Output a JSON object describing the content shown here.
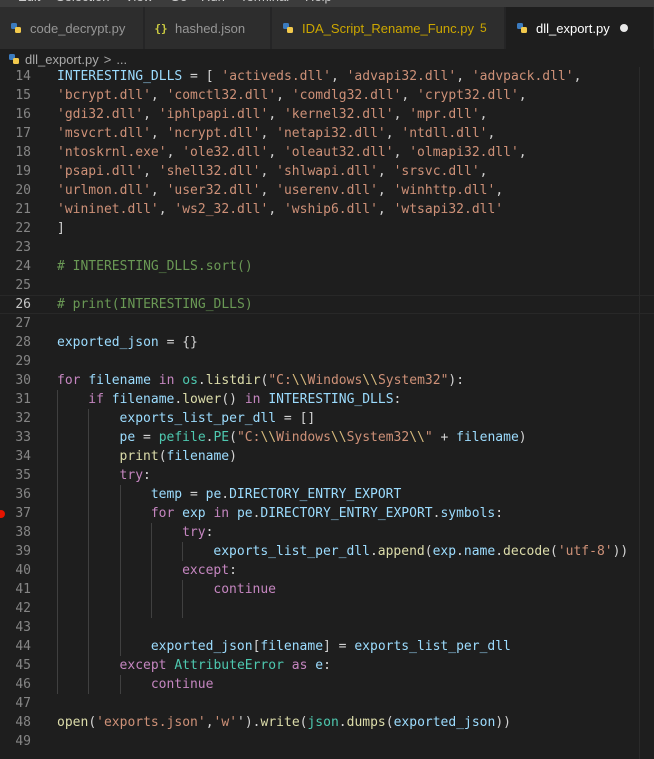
{
  "menu": [
    "Edit",
    "Selection",
    "View",
    "Go",
    "Run",
    "Terminal",
    "Help"
  ],
  "tabs": [
    {
      "label": "code_decrypt.py",
      "icon": "python-icon",
      "active": false
    },
    {
      "label": "hashed.json",
      "icon": "json-braces-icon",
      "active": false
    },
    {
      "label": "IDA_Script_Rename_Func.py",
      "icon": "python-icon",
      "active": false,
      "badge": "5"
    },
    {
      "label": "dll_export.py",
      "icon": "python-icon",
      "active": true,
      "unsaved_indicator": "dot"
    }
  ],
  "breadcrumb": {
    "file": "dll_export.py",
    "separator": ">",
    "rest": "..."
  },
  "current_line": 26,
  "breakpoint_line": 37,
  "lines": [
    {
      "n": "14",
      "indent": 0,
      "tokens": [
        [
          "var",
          "INTERESTING_DLLS"
        ],
        [
          "op",
          " = [ "
        ],
        [
          "str",
          "'activeds.dll'"
        ],
        [
          "op",
          ", "
        ],
        [
          "str",
          "'advapi32.dll'"
        ],
        [
          "op",
          ", "
        ],
        [
          "str",
          "'advpack.dll'"
        ],
        [
          "op",
          ","
        ]
      ]
    },
    {
      "n": "15",
      "indent": 0,
      "tokens": [
        [
          "str",
          "'bcrypt.dll'"
        ],
        [
          "op",
          ", "
        ],
        [
          "str",
          "'comctl32.dll'"
        ],
        [
          "op",
          ", "
        ],
        [
          "str",
          "'comdlg32.dll'"
        ],
        [
          "op",
          ", "
        ],
        [
          "str",
          "'crypt32.dll'"
        ],
        [
          "op",
          ","
        ]
      ]
    },
    {
      "n": "16",
      "indent": 0,
      "tokens": [
        [
          "str",
          "'gdi32.dll'"
        ],
        [
          "op",
          ", "
        ],
        [
          "str",
          "'iphlpapi.dll'"
        ],
        [
          "op",
          ", "
        ],
        [
          "str",
          "'kernel32.dll'"
        ],
        [
          "op",
          ", "
        ],
        [
          "str",
          "'mpr.dll'"
        ],
        [
          "op",
          ","
        ]
      ]
    },
    {
      "n": "17",
      "indent": 0,
      "tokens": [
        [
          "str",
          "'msvcrt.dll'"
        ],
        [
          "op",
          ", "
        ],
        [
          "str",
          "'ncrypt.dll'"
        ],
        [
          "op",
          ", "
        ],
        [
          "str",
          "'netapi32.dll'"
        ],
        [
          "op",
          ", "
        ],
        [
          "str",
          "'ntdll.dll'"
        ],
        [
          "op",
          ","
        ]
      ]
    },
    {
      "n": "18",
      "indent": 0,
      "tokens": [
        [
          "str",
          "'ntoskrnl.exe'"
        ],
        [
          "op",
          ", "
        ],
        [
          "str",
          "'ole32.dll'"
        ],
        [
          "op",
          ", "
        ],
        [
          "str",
          "'oleaut32.dll'"
        ],
        [
          "op",
          ", "
        ],
        [
          "str",
          "'olmapi32.dll'"
        ],
        [
          "op",
          ","
        ]
      ]
    },
    {
      "n": "19",
      "indent": 0,
      "tokens": [
        [
          "str",
          "'psapi.dll'"
        ],
        [
          "op",
          ", "
        ],
        [
          "str",
          "'shell32.dll'"
        ],
        [
          "op",
          ", "
        ],
        [
          "str",
          "'shlwapi.dll'"
        ],
        [
          "op",
          ", "
        ],
        [
          "str",
          "'srsvc.dll'"
        ],
        [
          "op",
          ","
        ]
      ]
    },
    {
      "n": "20",
      "indent": 0,
      "tokens": [
        [
          "str",
          "'urlmon.dll'"
        ],
        [
          "op",
          ", "
        ],
        [
          "str",
          "'user32.dll'"
        ],
        [
          "op",
          ", "
        ],
        [
          "str",
          "'userenv.dll'"
        ],
        [
          "op",
          ", "
        ],
        [
          "str",
          "'winhttp.dll'"
        ],
        [
          "op",
          ","
        ]
      ]
    },
    {
      "n": "21",
      "indent": 0,
      "tokens": [
        [
          "str",
          "'wininet.dll'"
        ],
        [
          "op",
          ", "
        ],
        [
          "str",
          "'ws2_32.dll'"
        ],
        [
          "op",
          ", "
        ],
        [
          "str",
          "'wship6.dll'"
        ],
        [
          "op",
          ", "
        ],
        [
          "str",
          "'wtsapi32.dll'"
        ]
      ]
    },
    {
      "n": "22",
      "indent": 0,
      "tokens": [
        [
          "op",
          "]"
        ]
      ]
    },
    {
      "n": "23",
      "indent": 0,
      "tokens": []
    },
    {
      "n": "24",
      "indent": 0,
      "tokens": [
        [
          "cm",
          "# INTERESTING_DLLS.sort()"
        ]
      ]
    },
    {
      "n": "25",
      "indent": 0,
      "tokens": []
    },
    {
      "n": "26",
      "indent": 0,
      "tokens": [
        [
          "cm",
          "# print(INTERESTING_DLLS)"
        ]
      ]
    },
    {
      "n": "27",
      "indent": 0,
      "tokens": []
    },
    {
      "n": "28",
      "indent": 0,
      "tokens": [
        [
          "var",
          "exported_json"
        ],
        [
          "op",
          " = {}"
        ]
      ]
    },
    {
      "n": "29",
      "indent": 0,
      "tokens": []
    },
    {
      "n": "30",
      "indent": 0,
      "tokens": [
        [
          "kw",
          "for"
        ],
        [
          "op",
          " "
        ],
        [
          "var",
          "filename"
        ],
        [
          "op",
          " "
        ],
        [
          "kw",
          "in"
        ],
        [
          "op",
          " "
        ],
        [
          "cls",
          "os"
        ],
        [
          "op",
          "."
        ],
        [
          "fn",
          "listdir"
        ],
        [
          "op",
          "("
        ],
        [
          "str",
          "\"C:"
        ],
        [
          "esc",
          "\\\\"
        ],
        [
          "str",
          "Windows"
        ],
        [
          "esc",
          "\\\\"
        ],
        [
          "str",
          "System32\""
        ],
        [
          "op",
          "):"
        ]
      ]
    },
    {
      "n": "31",
      "indent": 1,
      "tokens": [
        [
          "kw",
          "if"
        ],
        [
          "op",
          " "
        ],
        [
          "var",
          "filename"
        ],
        [
          "op",
          "."
        ],
        [
          "fn",
          "lower"
        ],
        [
          "op",
          "() "
        ],
        [
          "kw",
          "in"
        ],
        [
          "op",
          " "
        ],
        [
          "var",
          "INTERESTING_DLLS"
        ],
        [
          "op",
          ":"
        ]
      ]
    },
    {
      "n": "32",
      "indent": 2,
      "tokens": [
        [
          "var",
          "exports_list_per_dll"
        ],
        [
          "op",
          " = []"
        ]
      ]
    },
    {
      "n": "33",
      "indent": 2,
      "tokens": [
        [
          "var",
          "pe"
        ],
        [
          "op",
          " = "
        ],
        [
          "cls",
          "pefile"
        ],
        [
          "op",
          "."
        ],
        [
          "cls",
          "PE"
        ],
        [
          "op",
          "("
        ],
        [
          "str",
          "\"C:"
        ],
        [
          "esc",
          "\\\\"
        ],
        [
          "str",
          "Windows"
        ],
        [
          "esc",
          "\\\\"
        ],
        [
          "str",
          "System32"
        ],
        [
          "esc",
          "\\\\"
        ],
        [
          "str",
          "\""
        ],
        [
          "op",
          " + "
        ],
        [
          "var",
          "filename"
        ],
        [
          "op",
          ")"
        ]
      ]
    },
    {
      "n": "34",
      "indent": 2,
      "tokens": [
        [
          "fn",
          "print"
        ],
        [
          "op",
          "("
        ],
        [
          "var",
          "filename"
        ],
        [
          "op",
          ")"
        ]
      ]
    },
    {
      "n": "35",
      "indent": 2,
      "tokens": [
        [
          "kw",
          "try"
        ],
        [
          "op",
          ":"
        ]
      ]
    },
    {
      "n": "36",
      "indent": 3,
      "tokens": [
        [
          "var",
          "temp"
        ],
        [
          "op",
          " = "
        ],
        [
          "var",
          "pe"
        ],
        [
          "op",
          "."
        ],
        [
          "var",
          "DIRECTORY_ENTRY_EXPORT"
        ]
      ]
    },
    {
      "n": "37",
      "indent": 3,
      "tokens": [
        [
          "kw",
          "for"
        ],
        [
          "op",
          " "
        ],
        [
          "var",
          "exp"
        ],
        [
          "op",
          " "
        ],
        [
          "kw",
          "in"
        ],
        [
          "op",
          " "
        ],
        [
          "var",
          "pe"
        ],
        [
          "op",
          "."
        ],
        [
          "var",
          "DIRECTORY_ENTRY_EXPORT"
        ],
        [
          "op",
          "."
        ],
        [
          "var",
          "symbols"
        ],
        [
          "op",
          ":"
        ]
      ]
    },
    {
      "n": "38",
      "indent": 4,
      "tokens": [
        [
          "kw",
          "try"
        ],
        [
          "op",
          ":"
        ]
      ]
    },
    {
      "n": "39",
      "indent": 5,
      "tokens": [
        [
          "var",
          "exports_list_per_dll"
        ],
        [
          "op",
          "."
        ],
        [
          "fn",
          "append"
        ],
        [
          "op",
          "("
        ],
        [
          "var",
          "exp"
        ],
        [
          "op",
          "."
        ],
        [
          "var",
          "name"
        ],
        [
          "op",
          "."
        ],
        [
          "fn",
          "decode"
        ],
        [
          "op",
          "("
        ],
        [
          "str",
          "'utf-8'"
        ],
        [
          "op",
          "))"
        ]
      ]
    },
    {
      "n": "40",
      "indent": 4,
      "tokens": [
        [
          "kw",
          "except"
        ],
        [
          "op",
          ":"
        ]
      ]
    },
    {
      "n": "41",
      "indent": 5,
      "tokens": [
        [
          "kw",
          "continue"
        ]
      ]
    },
    {
      "n": "42",
      "indent": 0,
      "guides": 5,
      "tokens": []
    },
    {
      "n": "43",
      "indent": 0,
      "guides": 3,
      "tokens": []
    },
    {
      "n": "44",
      "indent": 3,
      "tokens": [
        [
          "var",
          "exported_json"
        ],
        [
          "op",
          "["
        ],
        [
          "var",
          "filename"
        ],
        [
          "op",
          "] = "
        ],
        [
          "var",
          "exports_list_per_dll"
        ]
      ]
    },
    {
      "n": "45",
      "indent": 2,
      "tokens": [
        [
          "kw",
          "except"
        ],
        [
          "op",
          " "
        ],
        [
          "cls",
          "AttributeError"
        ],
        [
          "op",
          " "
        ],
        [
          "kw",
          "as"
        ],
        [
          "op",
          " "
        ],
        [
          "var",
          "e"
        ],
        [
          "op",
          ":"
        ]
      ]
    },
    {
      "n": "46",
      "indent": 3,
      "tokens": [
        [
          "kw",
          "continue"
        ]
      ]
    },
    {
      "n": "47",
      "indent": 0,
      "tokens": []
    },
    {
      "n": "48",
      "indent": 0,
      "tokens": [
        [
          "fn",
          "open"
        ],
        [
          "op",
          "("
        ],
        [
          "str",
          "'exports.json'"
        ],
        [
          "op",
          ","
        ],
        [
          "str",
          "'w'"
        ],
        [
          "op",
          "')."
        ],
        [
          "fn",
          "write"
        ],
        [
          "op",
          "("
        ],
        [
          "cls",
          "json"
        ],
        [
          "op",
          "."
        ],
        [
          "fn",
          "dumps"
        ],
        [
          "op",
          "("
        ],
        [
          "var",
          "exported_json"
        ],
        [
          "op",
          "))"
        ]
      ]
    },
    {
      "n": "49",
      "indent": 0,
      "tokens": []
    }
  ]
}
